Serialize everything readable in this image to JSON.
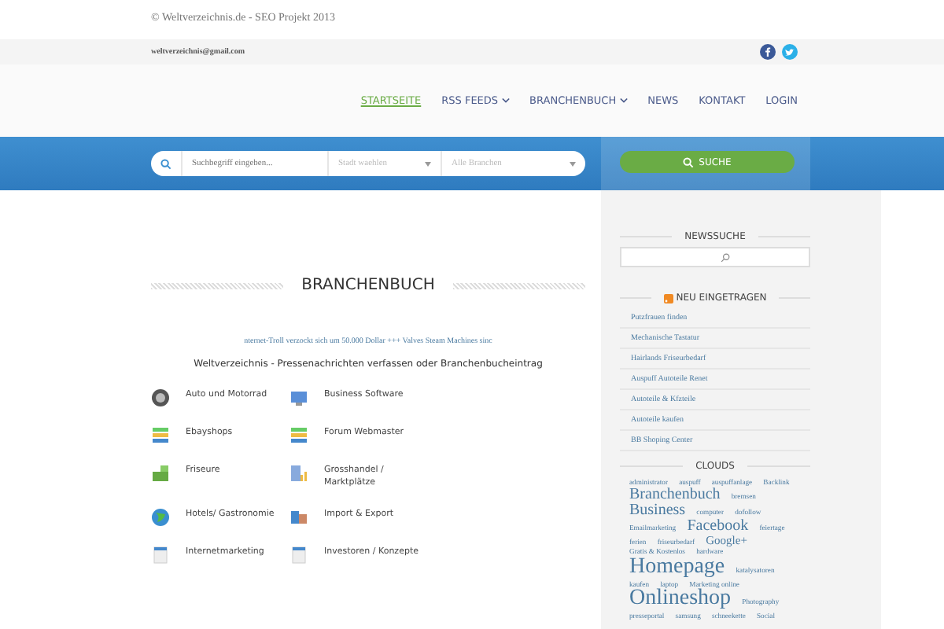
{
  "top_bar": {
    "copyright": "© Weltverzeichnis.de - SEO Projekt 2013"
  },
  "contact_bar": {
    "email": "weltverzeichnis@gmail.com"
  },
  "nav": [
    {
      "label": "STARTSEITE",
      "selected": true,
      "dropdown": false
    },
    {
      "label": "RSS FEEDS",
      "selected": false,
      "dropdown": true
    },
    {
      "label": "BRANCHENBUCH",
      "selected": false,
      "dropdown": true
    },
    {
      "label": "NEWS",
      "selected": false,
      "dropdown": false
    },
    {
      "label": "KONTAKT",
      "selected": false,
      "dropdown": false
    },
    {
      "label": "LOGIN",
      "selected": false,
      "dropdown": false
    }
  ],
  "search": {
    "placeholder": "Suchbegriff eingeben...",
    "city": "Stadt waehlen",
    "branch": "Alle Branchen",
    "button": "SUCHE"
  },
  "main": {
    "heading": "BRANCHENBUCH",
    "ticker": "nternet-Troll verzockt sich um 50.000 Dollar +++ Valves Steam Machines sinc",
    "intro": "Weltverzeichnis - Pressenachrichten verfassen oder Branchenbucheintrag",
    "categories": [
      [
        "Auto und Motorrad",
        "Business Software"
      ],
      [
        "Ebayshops",
        "Forum Webmaster"
      ],
      [
        "Friseure",
        "Grosshandel / Marktplätze"
      ],
      [
        "Hotels/ Gastronomie",
        "Import & Export"
      ],
      [
        "Internetmarketing",
        "Investoren / Konzepte"
      ]
    ]
  },
  "sidebar": {
    "news_search": {
      "title": "NEWSSUCHE"
    },
    "recent": {
      "title": "NEU EINGETRAGEN",
      "items": [
        "Putzfrauen finden",
        "Mechanische Tastatur",
        "Hairlands Friseurbedarf",
        "Auspuff Autoteile Renet",
        "Autoteile & Kfzteile",
        "Autoteile kaufen",
        "BB Shoping Center"
      ]
    },
    "clouds": {
      "title": "CLOUDS",
      "tags": [
        {
          "label": "administrator",
          "kind": "small"
        },
        {
          "label": "auspuff",
          "kind": "small"
        },
        {
          "label": "auspuffanlage",
          "kind": "small"
        },
        {
          "label": "Backlink",
          "kind": "small"
        },
        {
          "label": "Branchenbuch",
          "kind": "large"
        },
        {
          "label": "bremsen",
          "kind": "small"
        },
        {
          "label": "Business",
          "kind": "large"
        },
        {
          "label": "computer",
          "kind": "small"
        },
        {
          "label": "dofollow",
          "kind": "small"
        },
        {
          "label": "Emailmarketing",
          "kind": "small"
        },
        {
          "label": "Facebook",
          "kind": "large"
        },
        {
          "label": "feiertage",
          "kind": "small"
        },
        {
          "label": "ferien",
          "kind": "small"
        },
        {
          "label": "friseurbedarf",
          "kind": "small"
        },
        {
          "label": "Google+",
          "kind": "medium"
        },
        {
          "label": "Gratis & Kostenlos",
          "kind": "small"
        },
        {
          "label": "hardware",
          "kind": "small"
        },
        {
          "label": "Homepage",
          "kind": "huge"
        },
        {
          "label": "katalysatoren",
          "kind": "small"
        },
        {
          "label": "kaufen",
          "kind": "small"
        },
        {
          "label": "laptop",
          "kind": "small"
        },
        {
          "label": "Marketing online",
          "kind": "small"
        },
        {
          "label": "Onlineshop",
          "kind": "huge"
        },
        {
          "label": "Photography",
          "kind": "small"
        },
        {
          "label": "presseportal",
          "kind": "small"
        },
        {
          "label": "samsung",
          "kind": "small"
        },
        {
          "label": "schneekette",
          "kind": "small"
        },
        {
          "label": "Social",
          "kind": "small"
        }
      ]
    }
  }
}
